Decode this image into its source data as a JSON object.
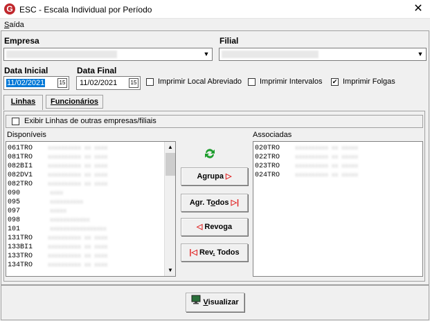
{
  "window": {
    "title": "ESC - Escala Individual por Período",
    "app_icon_letter": "G"
  },
  "menu": {
    "saida_first": "S",
    "saida_rest": "aída"
  },
  "fields": {
    "empresa_label": "Empresa",
    "empresa_value": "",
    "filial_label": "Filial",
    "filial_value": "",
    "data_inicial_label": "Data Inicial",
    "data_inicial_value": "11/02/2021",
    "data_final_label": "Data Final",
    "data_final_value": "11/02/2021",
    "cal_icon": "15"
  },
  "options": {
    "imprimir_local": {
      "label": "Imprimir Local Abreviado",
      "checked": false
    },
    "imprimir_intervalos": {
      "label": "Imprimir Intervalos",
      "checked": false
    },
    "imprimir_folgas": {
      "label": "Imprimir Folgas",
      "checked": true
    }
  },
  "tabs": {
    "linhas": "Linhas",
    "funcionarios": "Funcionários"
  },
  "exibir_linhas_label": "Exibir Linhas de outras empresas/filiais",
  "disponiveis": {
    "label": "Disponíveis",
    "items": [
      "061TRO",
      "081TRO",
      "082BI1",
      "082DV1",
      "082TRO",
      "090",
      "095",
      "097",
      "098",
      "101",
      "131TRO",
      "133BI1",
      "133TRO",
      "134TRO"
    ]
  },
  "associadas": {
    "label": "Associadas",
    "items": [
      "020TRO",
      "022TRO",
      "023TRO",
      "024TRO"
    ]
  },
  "buttons": {
    "agrupa": "Agrupa",
    "agr_todos_pre": "Agr. T",
    "agr_todos_u": "o",
    "agr_todos_post": "dos",
    "revoga_pre": "Revo",
    "revoga_u": "g",
    "revoga_post": "a",
    "rev_todos_pre": "Rev",
    "rev_todos_u": ".",
    "rev_todos_post": " Todos",
    "visualizar_u": "V",
    "visualizar_rest": "isualizar"
  }
}
